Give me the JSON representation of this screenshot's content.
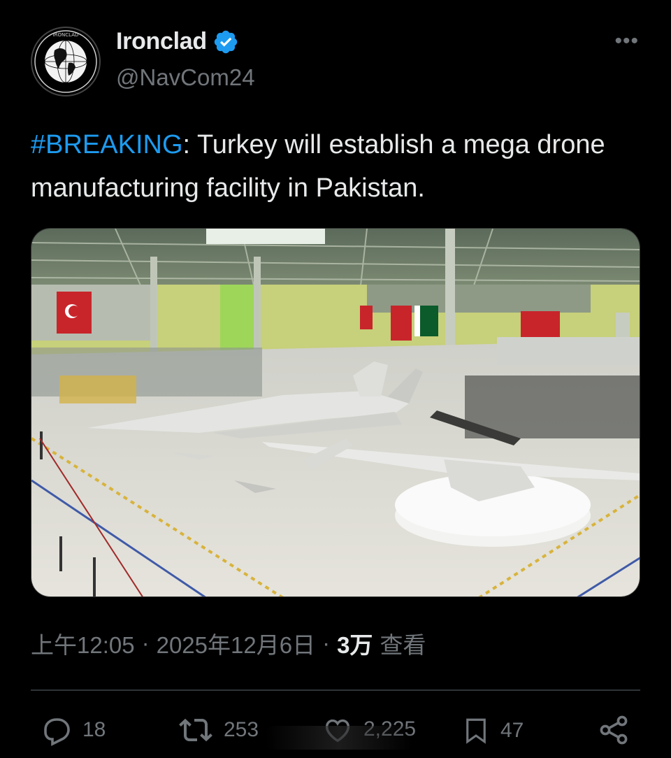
{
  "author": {
    "display_name": "Ironclad",
    "handle": "@NavCom24",
    "verified": true,
    "avatar_icon": "globe-logo-icon",
    "avatar_logo_text": "IRONCLAD"
  },
  "more_icon": "more-horizontal-icon",
  "tweet": {
    "hashtag": "#BREAKING",
    "text_after_hashtag": ": Turkey will establish a mega drone manufacturing facility in Pakistan."
  },
  "media": {
    "icon": "photo-drone-factory"
  },
  "meta": {
    "time": "上午12:05",
    "separator1": "·",
    "date": "2025年12月6日",
    "separator2": "·",
    "views_count": "3万",
    "views_label": "查看"
  },
  "actions": {
    "reply": {
      "icon": "reply-icon",
      "count": "18"
    },
    "retweet": {
      "icon": "retweet-icon",
      "count": "253"
    },
    "like": {
      "icon": "like-icon",
      "count": "2,225"
    },
    "bookmark": {
      "icon": "bookmark-icon",
      "count": "47"
    },
    "share": {
      "icon": "share-icon"
    }
  },
  "colors": {
    "background": "#000000",
    "text": "#e7e9ea",
    "muted": "#71767b",
    "link": "#1d9bf0",
    "verified": "#1d9bf0"
  }
}
